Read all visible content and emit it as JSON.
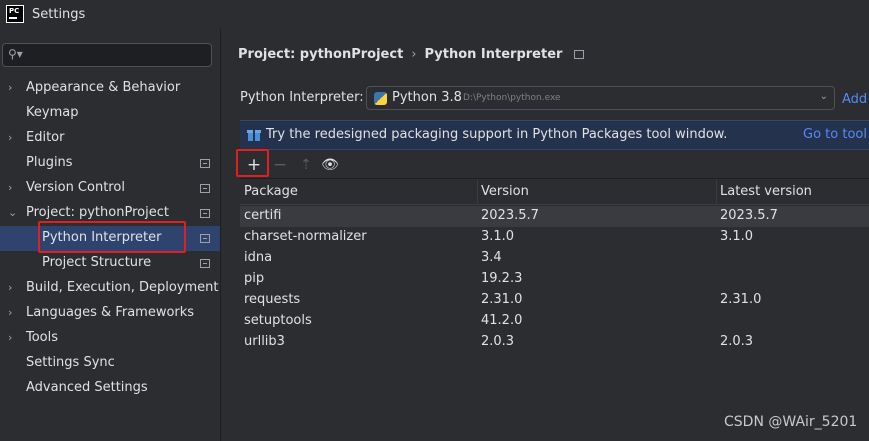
{
  "window": {
    "title": "Settings",
    "logo": "PC"
  },
  "sidebar": {
    "search_placeholder": "",
    "items": [
      {
        "label": "Appearance & Behavior",
        "expandable": true,
        "expanded": false,
        "modified_icon": false
      },
      {
        "label": "Keymap",
        "expandable": false,
        "modified_icon": false
      },
      {
        "label": "Editor",
        "expandable": true,
        "expanded": false,
        "modified_icon": false
      },
      {
        "label": "Plugins",
        "expandable": false,
        "modified_icon": true
      },
      {
        "label": "Version Control",
        "expandable": true,
        "expanded": false,
        "modified_icon": true
      },
      {
        "label": "Project: pythonProject",
        "expandable": true,
        "expanded": true,
        "modified_icon": true
      },
      {
        "label": "Python Interpreter",
        "sub": true,
        "selected": true,
        "modified_icon": true
      },
      {
        "label": "Project Structure",
        "sub": true,
        "modified_icon": true
      },
      {
        "label": "Build, Execution, Deployment",
        "expandable": true,
        "expanded": false,
        "modified_icon": false
      },
      {
        "label": "Languages & Frameworks",
        "expandable": true,
        "expanded": false,
        "modified_icon": false
      },
      {
        "label": "Tools",
        "expandable": true,
        "expanded": false,
        "modified_icon": false
      },
      {
        "label": "Settings Sync",
        "expandable": false,
        "modified_icon": false
      },
      {
        "label": "Advanced Settings",
        "expandable": false,
        "modified_icon": false
      }
    ]
  },
  "breadcrumb": {
    "project": "Project: pythonProject",
    "separator": "›",
    "page": "Python Interpreter"
  },
  "interpreter": {
    "label": "Python Interpreter:",
    "selected_name": "Python 3.8",
    "selected_path": "D:\\Python\\python.exe",
    "add_link": "Add"
  },
  "banner": {
    "text": "Try the redesigned packaging support in Python Packages tool window.",
    "link": "Go to tool"
  },
  "table": {
    "columns": [
      "Package",
      "Version",
      "Latest version"
    ],
    "rows": [
      {
        "package": "certifi",
        "version": "2023.5.7",
        "latest": "2023.5.7"
      },
      {
        "package": "charset-normalizer",
        "version": "3.1.0",
        "latest": "3.1.0"
      },
      {
        "package": "idna",
        "version": "3.4",
        "latest": ""
      },
      {
        "package": "pip",
        "version": "19.2.3",
        "latest": ""
      },
      {
        "package": "requests",
        "version": "2.31.0",
        "latest": "2.31.0"
      },
      {
        "package": "setuptools",
        "version": "41.2.0",
        "latest": ""
      },
      {
        "package": "urllib3",
        "version": "2.0.3",
        "latest": "2.0.3"
      }
    ]
  },
  "watermark": "CSDN @WAir_5201",
  "colors": {
    "accent": "#548af7",
    "selection": "#2e436e",
    "highlight_box": "#e02020"
  }
}
